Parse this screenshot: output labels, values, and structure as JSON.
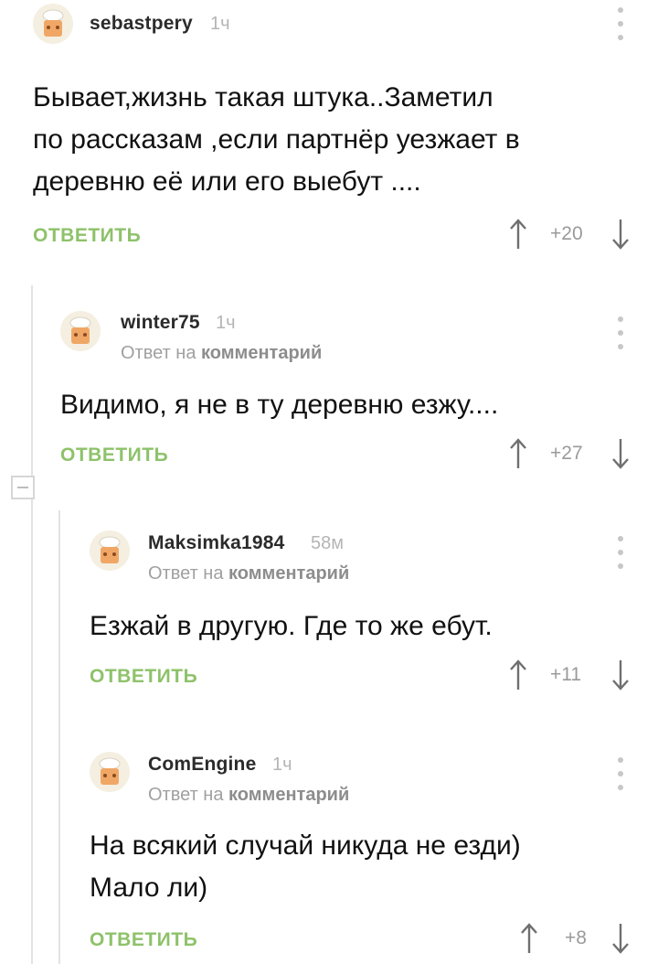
{
  "comments": [
    {
      "author": "sebastpery",
      "time": "1ч",
      "reply_to": null,
      "text": "Бывает,жизнь такая штука..Заметил\nпо рассказам ,если партнёр уезжает в\nдеревню её или его выебут ....",
      "reply_label": "ОТВЕТИТЬ",
      "score": "+20"
    },
    {
      "author": "winter75",
      "time": "1ч",
      "reply_to": {
        "prefix": "Ответ на",
        "target": "комментарий"
      },
      "text": "Видимо, я не в ту деревню езжу....",
      "reply_label": "ОТВЕТИТЬ",
      "score": "+27"
    },
    {
      "author": "Maksimka1984",
      "time": "58м",
      "reply_to": {
        "prefix": "Ответ на",
        "target": "комментарий"
      },
      "text": "Езжай в другую. Где то же ебут.",
      "reply_label": "ОТВЕТИТЬ",
      "score": "+11"
    },
    {
      "author": "ComEngine",
      "time": "1ч",
      "reply_to": {
        "prefix": "Ответ на",
        "target": "комментарий"
      },
      "text": "На всякий случай никуда не езди)\nМало ли)",
      "reply_label": "ОТВЕТИТЬ",
      "score": "+8"
    }
  ],
  "colors": {
    "accent_green": "#8ec26a",
    "muted_text": "#a0a0a0",
    "thread_line": "#e3e3e3"
  },
  "icons": [
    "avatar-icon",
    "more-vertical-icon",
    "upvote-arrow-icon",
    "downvote-arrow-icon",
    "collapse-icon"
  ]
}
